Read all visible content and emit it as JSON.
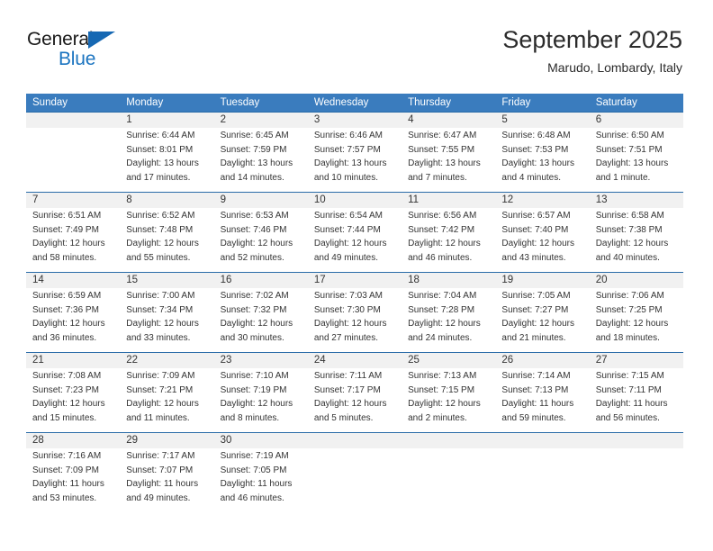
{
  "brand": {
    "name_part1": "General",
    "name_part2": "Blue",
    "triangle_icon": "triangle-icon",
    "accent_color": "#1b74c0"
  },
  "header": {
    "title": "September 2025",
    "location": "Marudo, Lombardy, Italy"
  },
  "theme": {
    "header_row_bg": "#3a7cbe",
    "week_separator": "#2a6ca8",
    "daynum_band_bg": "#f1f1f1",
    "text": "#333333"
  },
  "weekdays": [
    "Sunday",
    "Monday",
    "Tuesday",
    "Wednesday",
    "Thursday",
    "Friday",
    "Saturday"
  ],
  "weeks": [
    [
      {
        "num": "",
        "sunrise": "",
        "sunset": "",
        "daylight1": "",
        "daylight2": "",
        "empty": true
      },
      {
        "num": "1",
        "sunrise": "Sunrise: 6:44 AM",
        "sunset": "Sunset: 8:01 PM",
        "daylight1": "Daylight: 13 hours",
        "daylight2": "and 17 minutes."
      },
      {
        "num": "2",
        "sunrise": "Sunrise: 6:45 AM",
        "sunset": "Sunset: 7:59 PM",
        "daylight1": "Daylight: 13 hours",
        "daylight2": "and 14 minutes."
      },
      {
        "num": "3",
        "sunrise": "Sunrise: 6:46 AM",
        "sunset": "Sunset: 7:57 PM",
        "daylight1": "Daylight: 13 hours",
        "daylight2": "and 10 minutes."
      },
      {
        "num": "4",
        "sunrise": "Sunrise: 6:47 AM",
        "sunset": "Sunset: 7:55 PM",
        "daylight1": "Daylight: 13 hours",
        "daylight2": "and 7 minutes."
      },
      {
        "num": "5",
        "sunrise": "Sunrise: 6:48 AM",
        "sunset": "Sunset: 7:53 PM",
        "daylight1": "Daylight: 13 hours",
        "daylight2": "and 4 minutes."
      },
      {
        "num": "6",
        "sunrise": "Sunrise: 6:50 AM",
        "sunset": "Sunset: 7:51 PM",
        "daylight1": "Daylight: 13 hours",
        "daylight2": "and 1 minute."
      }
    ],
    [
      {
        "num": "7",
        "sunrise": "Sunrise: 6:51 AM",
        "sunset": "Sunset: 7:49 PM",
        "daylight1": "Daylight: 12 hours",
        "daylight2": "and 58 minutes."
      },
      {
        "num": "8",
        "sunrise": "Sunrise: 6:52 AM",
        "sunset": "Sunset: 7:48 PM",
        "daylight1": "Daylight: 12 hours",
        "daylight2": "and 55 minutes."
      },
      {
        "num": "9",
        "sunrise": "Sunrise: 6:53 AM",
        "sunset": "Sunset: 7:46 PM",
        "daylight1": "Daylight: 12 hours",
        "daylight2": "and 52 minutes."
      },
      {
        "num": "10",
        "sunrise": "Sunrise: 6:54 AM",
        "sunset": "Sunset: 7:44 PM",
        "daylight1": "Daylight: 12 hours",
        "daylight2": "and 49 minutes."
      },
      {
        "num": "11",
        "sunrise": "Sunrise: 6:56 AM",
        "sunset": "Sunset: 7:42 PM",
        "daylight1": "Daylight: 12 hours",
        "daylight2": "and 46 minutes."
      },
      {
        "num": "12",
        "sunrise": "Sunrise: 6:57 AM",
        "sunset": "Sunset: 7:40 PM",
        "daylight1": "Daylight: 12 hours",
        "daylight2": "and 43 minutes."
      },
      {
        "num": "13",
        "sunrise": "Sunrise: 6:58 AM",
        "sunset": "Sunset: 7:38 PM",
        "daylight1": "Daylight: 12 hours",
        "daylight2": "and 40 minutes."
      }
    ],
    [
      {
        "num": "14",
        "sunrise": "Sunrise: 6:59 AM",
        "sunset": "Sunset: 7:36 PM",
        "daylight1": "Daylight: 12 hours",
        "daylight2": "and 36 minutes."
      },
      {
        "num": "15",
        "sunrise": "Sunrise: 7:00 AM",
        "sunset": "Sunset: 7:34 PM",
        "daylight1": "Daylight: 12 hours",
        "daylight2": "and 33 minutes."
      },
      {
        "num": "16",
        "sunrise": "Sunrise: 7:02 AM",
        "sunset": "Sunset: 7:32 PM",
        "daylight1": "Daylight: 12 hours",
        "daylight2": "and 30 minutes."
      },
      {
        "num": "17",
        "sunrise": "Sunrise: 7:03 AM",
        "sunset": "Sunset: 7:30 PM",
        "daylight1": "Daylight: 12 hours",
        "daylight2": "and 27 minutes."
      },
      {
        "num": "18",
        "sunrise": "Sunrise: 7:04 AM",
        "sunset": "Sunset: 7:28 PM",
        "daylight1": "Daylight: 12 hours",
        "daylight2": "and 24 minutes."
      },
      {
        "num": "19",
        "sunrise": "Sunrise: 7:05 AM",
        "sunset": "Sunset: 7:27 PM",
        "daylight1": "Daylight: 12 hours",
        "daylight2": "and 21 minutes."
      },
      {
        "num": "20",
        "sunrise": "Sunrise: 7:06 AM",
        "sunset": "Sunset: 7:25 PM",
        "daylight1": "Daylight: 12 hours",
        "daylight2": "and 18 minutes."
      }
    ],
    [
      {
        "num": "21",
        "sunrise": "Sunrise: 7:08 AM",
        "sunset": "Sunset: 7:23 PM",
        "daylight1": "Daylight: 12 hours",
        "daylight2": "and 15 minutes."
      },
      {
        "num": "22",
        "sunrise": "Sunrise: 7:09 AM",
        "sunset": "Sunset: 7:21 PM",
        "daylight1": "Daylight: 12 hours",
        "daylight2": "and 11 minutes."
      },
      {
        "num": "23",
        "sunrise": "Sunrise: 7:10 AM",
        "sunset": "Sunset: 7:19 PM",
        "daylight1": "Daylight: 12 hours",
        "daylight2": "and 8 minutes."
      },
      {
        "num": "24",
        "sunrise": "Sunrise: 7:11 AM",
        "sunset": "Sunset: 7:17 PM",
        "daylight1": "Daylight: 12 hours",
        "daylight2": "and 5 minutes."
      },
      {
        "num": "25",
        "sunrise": "Sunrise: 7:13 AM",
        "sunset": "Sunset: 7:15 PM",
        "daylight1": "Daylight: 12 hours",
        "daylight2": "and 2 minutes."
      },
      {
        "num": "26",
        "sunrise": "Sunrise: 7:14 AM",
        "sunset": "Sunset: 7:13 PM",
        "daylight1": "Daylight: 11 hours",
        "daylight2": "and 59 minutes."
      },
      {
        "num": "27",
        "sunrise": "Sunrise: 7:15 AM",
        "sunset": "Sunset: 7:11 PM",
        "daylight1": "Daylight: 11 hours",
        "daylight2": "and 56 minutes."
      }
    ],
    [
      {
        "num": "28",
        "sunrise": "Sunrise: 7:16 AM",
        "sunset": "Sunset: 7:09 PM",
        "daylight1": "Daylight: 11 hours",
        "daylight2": "and 53 minutes."
      },
      {
        "num": "29",
        "sunrise": "Sunrise: 7:17 AM",
        "sunset": "Sunset: 7:07 PM",
        "daylight1": "Daylight: 11 hours",
        "daylight2": "and 49 minutes."
      },
      {
        "num": "30",
        "sunrise": "Sunrise: 7:19 AM",
        "sunset": "Sunset: 7:05 PM",
        "daylight1": "Daylight: 11 hours",
        "daylight2": "and 46 minutes."
      },
      {
        "num": "",
        "sunrise": "",
        "sunset": "",
        "daylight1": "",
        "daylight2": "",
        "empty": true
      },
      {
        "num": "",
        "sunrise": "",
        "sunset": "",
        "daylight1": "",
        "daylight2": "",
        "empty": true
      },
      {
        "num": "",
        "sunrise": "",
        "sunset": "",
        "daylight1": "",
        "daylight2": "",
        "empty": true
      },
      {
        "num": "",
        "sunrise": "",
        "sunset": "",
        "daylight1": "",
        "daylight2": "",
        "empty": true
      }
    ]
  ]
}
